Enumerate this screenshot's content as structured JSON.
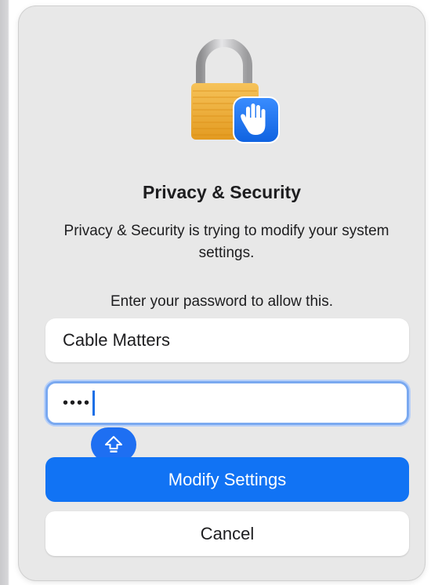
{
  "dialog": {
    "title": "Privacy & Security",
    "message": "Privacy & Security is trying to modify your system settings.",
    "prompt": "Enter your password to allow this.",
    "username_value": "Cable Matters",
    "password_masked": "••••",
    "primary_button_label": "Modify Settings",
    "secondary_button_label": "Cancel",
    "icons": {
      "app_icon": "padlock-with-hand-icon",
      "caps_lock": "caps-lock-icon"
    }
  },
  "colors": {
    "accent": "#1173f4",
    "dialog_background": "#e8e8e8",
    "focus_ring": "#7aa9f0"
  }
}
